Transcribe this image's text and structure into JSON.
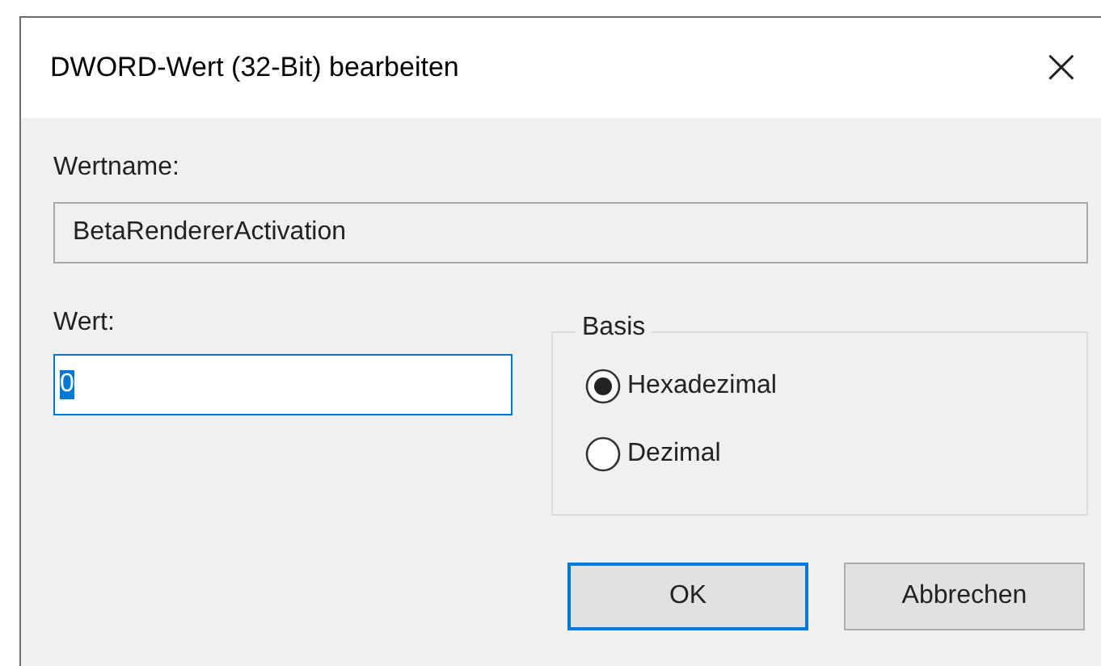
{
  "window": {
    "title": "DWORD-Wert (32-Bit) bearbeiten",
    "close": "×"
  },
  "name_field": {
    "label": "Wertname:",
    "value": "BetaRendererActivation"
  },
  "value_field": {
    "label": "Wert:",
    "value": "0",
    "text_selected": true
  },
  "base_group": {
    "title": "Basis",
    "options": [
      {
        "label": "Hexadezimal",
        "selected": true
      },
      {
        "label": "Dezimal",
        "selected": false
      }
    ]
  },
  "buttons": [
    {
      "label": "OK",
      "default": true
    },
    {
      "label": "Abbrechen",
      "default": false
    }
  ]
}
